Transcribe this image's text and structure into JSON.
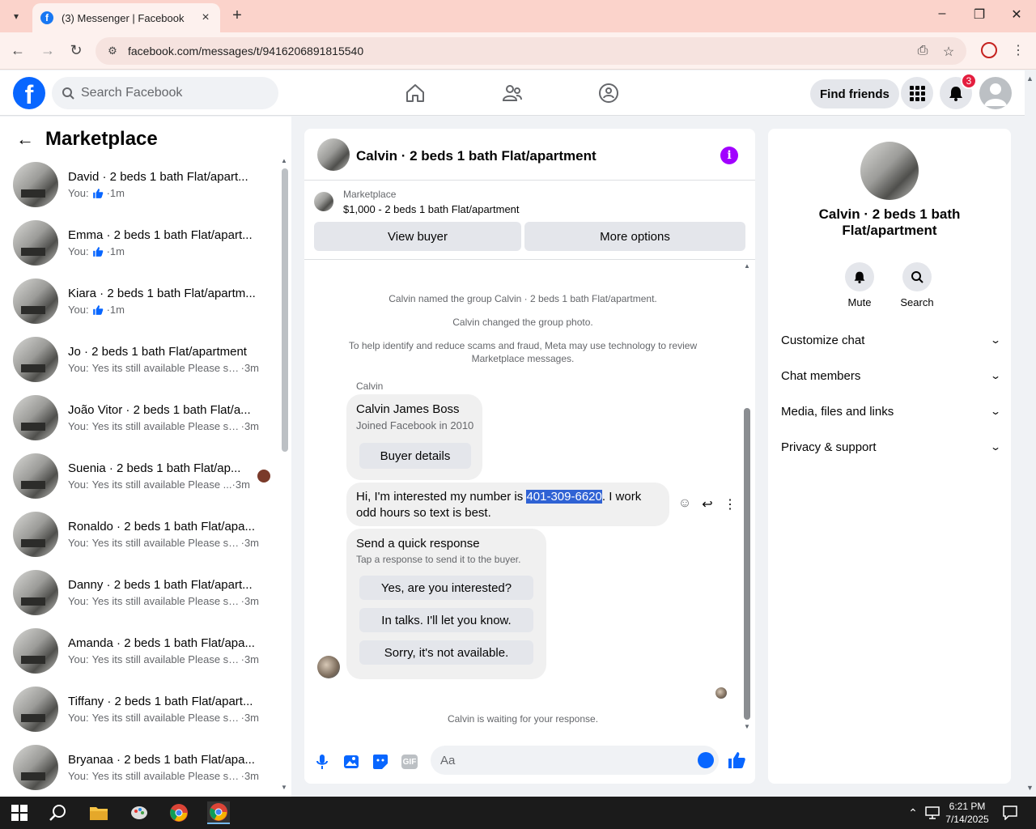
{
  "browser": {
    "tab_title": "(3) Messenger | Facebook",
    "url": "facebook.com/messages/t/9416206891815540"
  },
  "fb_header": {
    "search_placeholder": "Search Facebook",
    "find_friends_label": "Find friends",
    "notifications_count": "3"
  },
  "sidebar": {
    "title": "Marketplace",
    "conversations": [
      {
        "name": "David · 2 beds 1 bath Flat/apart...",
        "prefix": "You:",
        "message": "",
        "time": "1m",
        "liked": true
      },
      {
        "name": "Emma · 2 beds 1 bath Flat/apart...",
        "prefix": "You:",
        "message": "",
        "time": "1m",
        "liked": true
      },
      {
        "name": "Kiara · 2 beds 1 bath Flat/apartm...",
        "prefix": "You:",
        "message": "",
        "time": "1m",
        "liked": true
      },
      {
        "name": "Jo · 2 beds 1 bath Flat/apartment",
        "prefix": "You:",
        "message": "Yes its still available Please se...",
        "time": "3m"
      },
      {
        "name": "João Vitor · 2 beds 1 bath Flat/a...",
        "prefix": "You:",
        "message": "Yes its still available Please se...",
        "time": "3m"
      },
      {
        "name": "Suenia · 2 beds 1 bath Flat/ap...",
        "prefix": "You:",
        "message": "Yes its still available Please ...",
        "time": "3m"
      },
      {
        "name": "Ronaldo · 2 beds 1 bath Flat/apa...",
        "prefix": "You:",
        "message": "Yes its still available Please se...",
        "time": "3m"
      },
      {
        "name": "Danny · 2 beds 1 bath Flat/apart...",
        "prefix": "You:",
        "message": "Yes its still available Please se...",
        "time": "3m"
      },
      {
        "name": "Amanda · 2 beds 1 bath Flat/apa...",
        "prefix": "You:",
        "message": "Yes its still available Please se...",
        "time": "3m"
      },
      {
        "name": "Tiffany · 2 beds 1 bath Flat/apart...",
        "prefix": "You:",
        "message": "Yes its still available Please se...",
        "time": "3m"
      },
      {
        "name": "Bryanaa · 2 beds 1 bath Flat/apa...",
        "prefix": "You:",
        "message": "Yes its still available Please se...",
        "time": "3m"
      }
    ]
  },
  "chat": {
    "title": "Calvin · 2 beds 1 bath Flat/apartment",
    "marketplace_label": "Marketplace",
    "listing": "$1,000 - 2 beds 1 bath Flat/apartment",
    "view_buyer_label": "View buyer",
    "more_options_label": "More options",
    "system_1": "Calvin named the group Calvin · 2 beds 1 bath Flat/apartment.",
    "system_2": "Calvin changed the group photo.",
    "system_3": "To help identify and reduce scams and fraud, Meta may use technology to review Marketplace messages.",
    "sender": "Calvin",
    "card_name": "Calvin James Boss",
    "card_sub": "Joined Facebook in 2010",
    "buyer_details_label": "Buyer details",
    "message_before": "Hi, I'm interested my number is ",
    "message_phone": "401-309-6620",
    "message_after": ". I work odd hours so text is best.",
    "quick_title": "Send a quick response",
    "quick_sub": "Tap a response to send it to the buyer.",
    "quick_responses": [
      "Yes, are you interested?",
      "In talks. I'll let you know.",
      "Sorry, it's not available."
    ],
    "waiting_text": "Calvin is waiting for your response.",
    "composer_placeholder": "Aa"
  },
  "right_panel": {
    "title": "Calvin · 2 beds 1 bath Flat/apartment",
    "mute_label": "Mute",
    "search_label": "Search",
    "sections": [
      "Customize chat",
      "Chat members",
      "Media, files and links",
      "Privacy & support"
    ]
  },
  "taskbar": {
    "time": "6:21 PM",
    "date": "7/14/2025"
  },
  "colors": {
    "fb_blue": "#0866ff",
    "info_purple": "#a100ff",
    "badge_red": "#e41e3f",
    "tab_bg": "#fbd3cb",
    "highlight": "#2f62d4"
  }
}
